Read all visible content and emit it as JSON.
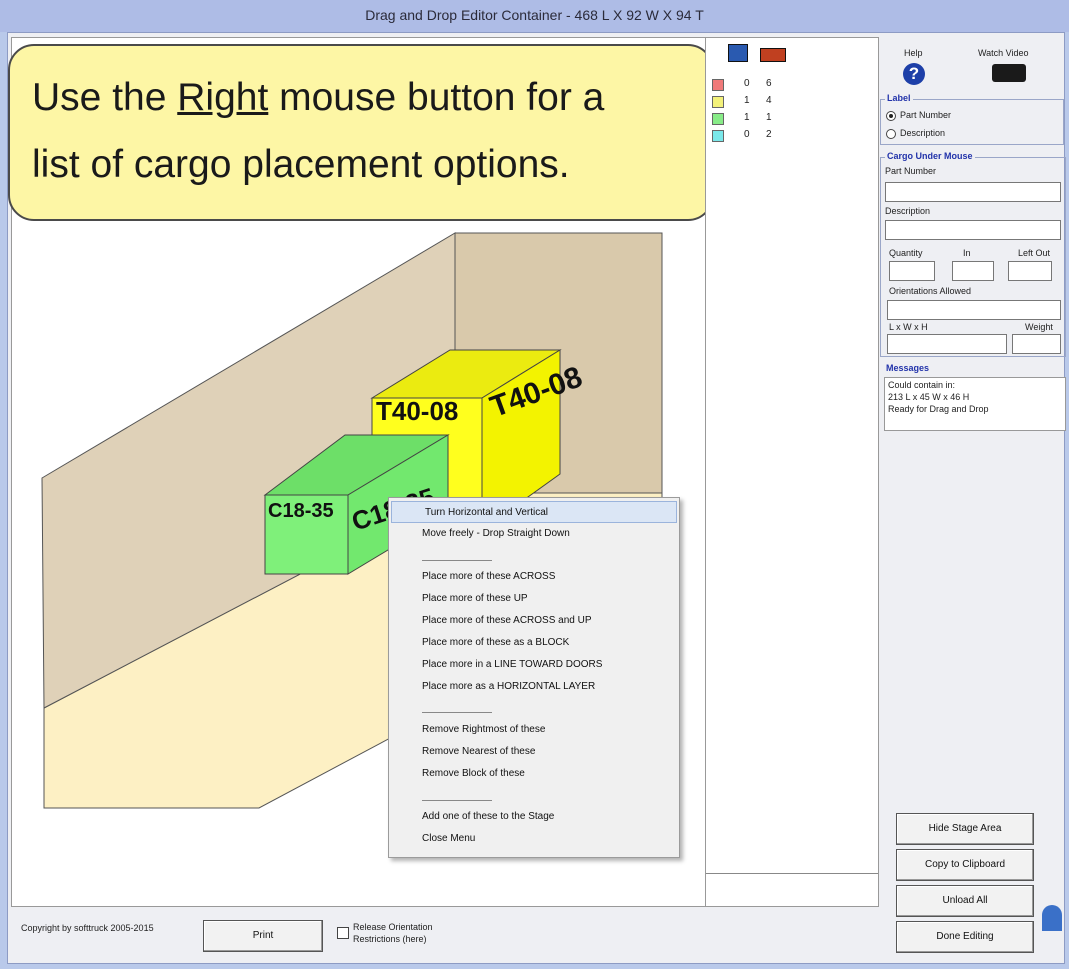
{
  "window": {
    "title": "Drag and Drop Editor    Container - 468 L X 92 W X 94 T"
  },
  "callout": {
    "line1_pre": "Use the ",
    "line1_em": "Right",
    "line1_post": " mouse button for a",
    "line2": "list of cargo placement options."
  },
  "scene": {
    "box_yellow_front": "T40-08",
    "box_yellow_side": "T40-08",
    "box_green_front": "C18-35",
    "box_green_side": "C18-35"
  },
  "cargo_list": {
    "rows": [
      {
        "color": "#f07a7a",
        "a": "0",
        "b": "6"
      },
      {
        "color": "#f3f17a",
        "a": "1",
        "b": "4"
      },
      {
        "color": "#88ec88",
        "a": "1",
        "b": "1"
      },
      {
        "color": "#7ae8ea",
        "a": "0",
        "b": "2"
      }
    ]
  },
  "context_menu": {
    "items": [
      "Turn Horizontal and Vertical",
      "Move freely - Drop Straight Down",
      "Place more of these ACROSS",
      "Place more of these UP",
      "Place more of these ACROSS and UP",
      "Place more of these as a BLOCK",
      "Place more in a LINE TOWARD DOORS",
      "Place more as a HORIZONTAL LAYER",
      "Remove Rightmost of these",
      "Remove Nearest of these",
      "Remove Block of these",
      "Add one of these to the Stage",
      "Close Menu"
    ],
    "separator": "________________"
  },
  "right_panel": {
    "help_label": "Help",
    "watch_label": "Watch Video",
    "label_group": "Label",
    "opt_part": "Part Number",
    "opt_desc": "Description",
    "cargo_group": "Cargo Under Mouse",
    "part_number": "Part Number",
    "description": "Description",
    "quantity": "Quantity",
    "in": "In",
    "left_out": "Left Out",
    "orientations": "Orientations Allowed",
    "lwh": "L x W x H",
    "weight": "Weight",
    "messages_group": "Messages",
    "messages": [
      "Could contain in:",
      "213 L x 45 W x 46 H",
      "Ready for Drag and Drop"
    ],
    "btn_hide": "Hide Stage Area",
    "btn_copy": "Copy to Clipboard",
    "btn_unload": "Unload All",
    "btn_done": "Done Editing"
  },
  "bottom": {
    "copyright": "Copyright by softtruck 2005-2015",
    "print": "Print",
    "release_line1": "Release Orientation",
    "release_line2": "Restrictions (here)"
  },
  "colors": {
    "yellow_box": "#ffff1e",
    "green_box": "#7ff07a",
    "wall": "#dfd1b8",
    "floor": "#fdf0c4",
    "callout": "#fdf6a5"
  }
}
